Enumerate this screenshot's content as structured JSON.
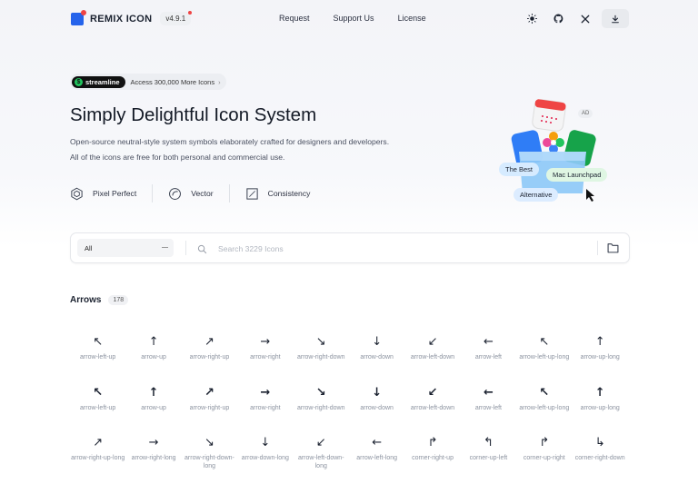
{
  "header": {
    "brand": "REMIX ICON",
    "version": "v4.9.1",
    "nav": [
      "Request",
      "Support Us",
      "License"
    ],
    "icons": [
      "sun-icon",
      "github-icon",
      "x-icon",
      "download-icon"
    ]
  },
  "promo": {
    "badge": "streamline",
    "text": "Access 300,000 More Icons"
  },
  "hero": {
    "title": "Simply Delightful Icon System",
    "desc_line1": "Open-source neutral-style system symbols elaborately crafted for designers and developers.",
    "desc_line2": "All of the icons are free for both personal and commercial use.",
    "features": [
      "Pixel Perfect",
      "Vector",
      "Consistency"
    ]
  },
  "illustration": {
    "ad": "AD",
    "tags": [
      "The Best",
      "Mac Launchpad",
      "Alternative"
    ]
  },
  "search": {
    "category": "All",
    "placeholder": "Search 3229 Icons"
  },
  "section": {
    "title": "Arrows",
    "count": "178",
    "icons": [
      {
        "name": "arrow-left-up",
        "label": "arrow-left-up",
        "glyph": "↖"
      },
      {
        "name": "arrow-up",
        "label": "arrow-up",
        "glyph": "↑"
      },
      {
        "name": "arrow-right-up",
        "label": "arrow-right-up",
        "glyph": "↗"
      },
      {
        "name": "arrow-right",
        "label": "arrow-right",
        "glyph": "→"
      },
      {
        "name": "arrow-right-down",
        "label": "arrow-right-down",
        "glyph": "↘"
      },
      {
        "name": "arrow-down",
        "label": "arrow-down",
        "glyph": "↓"
      },
      {
        "name": "arrow-left-down",
        "label": "arrow-left-down",
        "glyph": "↙"
      },
      {
        "name": "arrow-left",
        "label": "arrow-left",
        "glyph": "←"
      },
      {
        "name": "arrow-left-up-long",
        "label": "arrow-left-up-long",
        "glyph": "↖"
      },
      {
        "name": "arrow-up-long",
        "label": "arrow-up-long",
        "glyph": "↑"
      },
      {
        "name": "arrow-left-up-fill",
        "label": "arrow-left-up",
        "glyph": "↖"
      },
      {
        "name": "arrow-up-fill",
        "label": "arrow-up",
        "glyph": "↑"
      },
      {
        "name": "arrow-right-up-fill",
        "label": "arrow-right-up",
        "glyph": "↗"
      },
      {
        "name": "arrow-right-fill",
        "label": "arrow-right",
        "glyph": "→"
      },
      {
        "name": "arrow-right-down-fill",
        "label": "arrow-right-down",
        "glyph": "↘"
      },
      {
        "name": "arrow-down-fill",
        "label": "arrow-down",
        "glyph": "↓"
      },
      {
        "name": "arrow-left-down-fill",
        "label": "arrow-left-down",
        "glyph": "↙"
      },
      {
        "name": "arrow-left-fill",
        "label": "arrow-left",
        "glyph": "←"
      },
      {
        "name": "arrow-left-up-long-fill",
        "label": "arrow-left-up-long",
        "glyph": "↖"
      },
      {
        "name": "arrow-up-long-fill",
        "label": "arrow-up-long",
        "glyph": "↑"
      },
      {
        "name": "arrow-right-up-long",
        "label": "arrow-right-up-long",
        "glyph": "↗"
      },
      {
        "name": "arrow-right-long",
        "label": "arrow-right-long",
        "glyph": "→"
      },
      {
        "name": "arrow-right-down-long",
        "label": "arrow-right-down-long",
        "glyph": "↘"
      },
      {
        "name": "arrow-down-long",
        "label": "arrow-down-long",
        "glyph": "↓"
      },
      {
        "name": "arrow-left-down-long",
        "label": "arrow-left-down-long",
        "glyph": "↙"
      },
      {
        "name": "arrow-left-long",
        "label": "arrow-left-long",
        "glyph": "←"
      },
      {
        "name": "corner-right-up",
        "label": "corner-right-up",
        "glyph": "↱"
      },
      {
        "name": "corner-up-left",
        "label": "corner-up-left",
        "glyph": "↰"
      },
      {
        "name": "corner-up-right",
        "label": "corner-up-right",
        "glyph": "↱"
      },
      {
        "name": "corner-right-down",
        "label": "corner-right-down",
        "glyph": "↳"
      }
    ]
  },
  "colors": {
    "accent": "#2563eb",
    "brand_dot": "#ef4444",
    "label_gray": "#8c93a0"
  }
}
